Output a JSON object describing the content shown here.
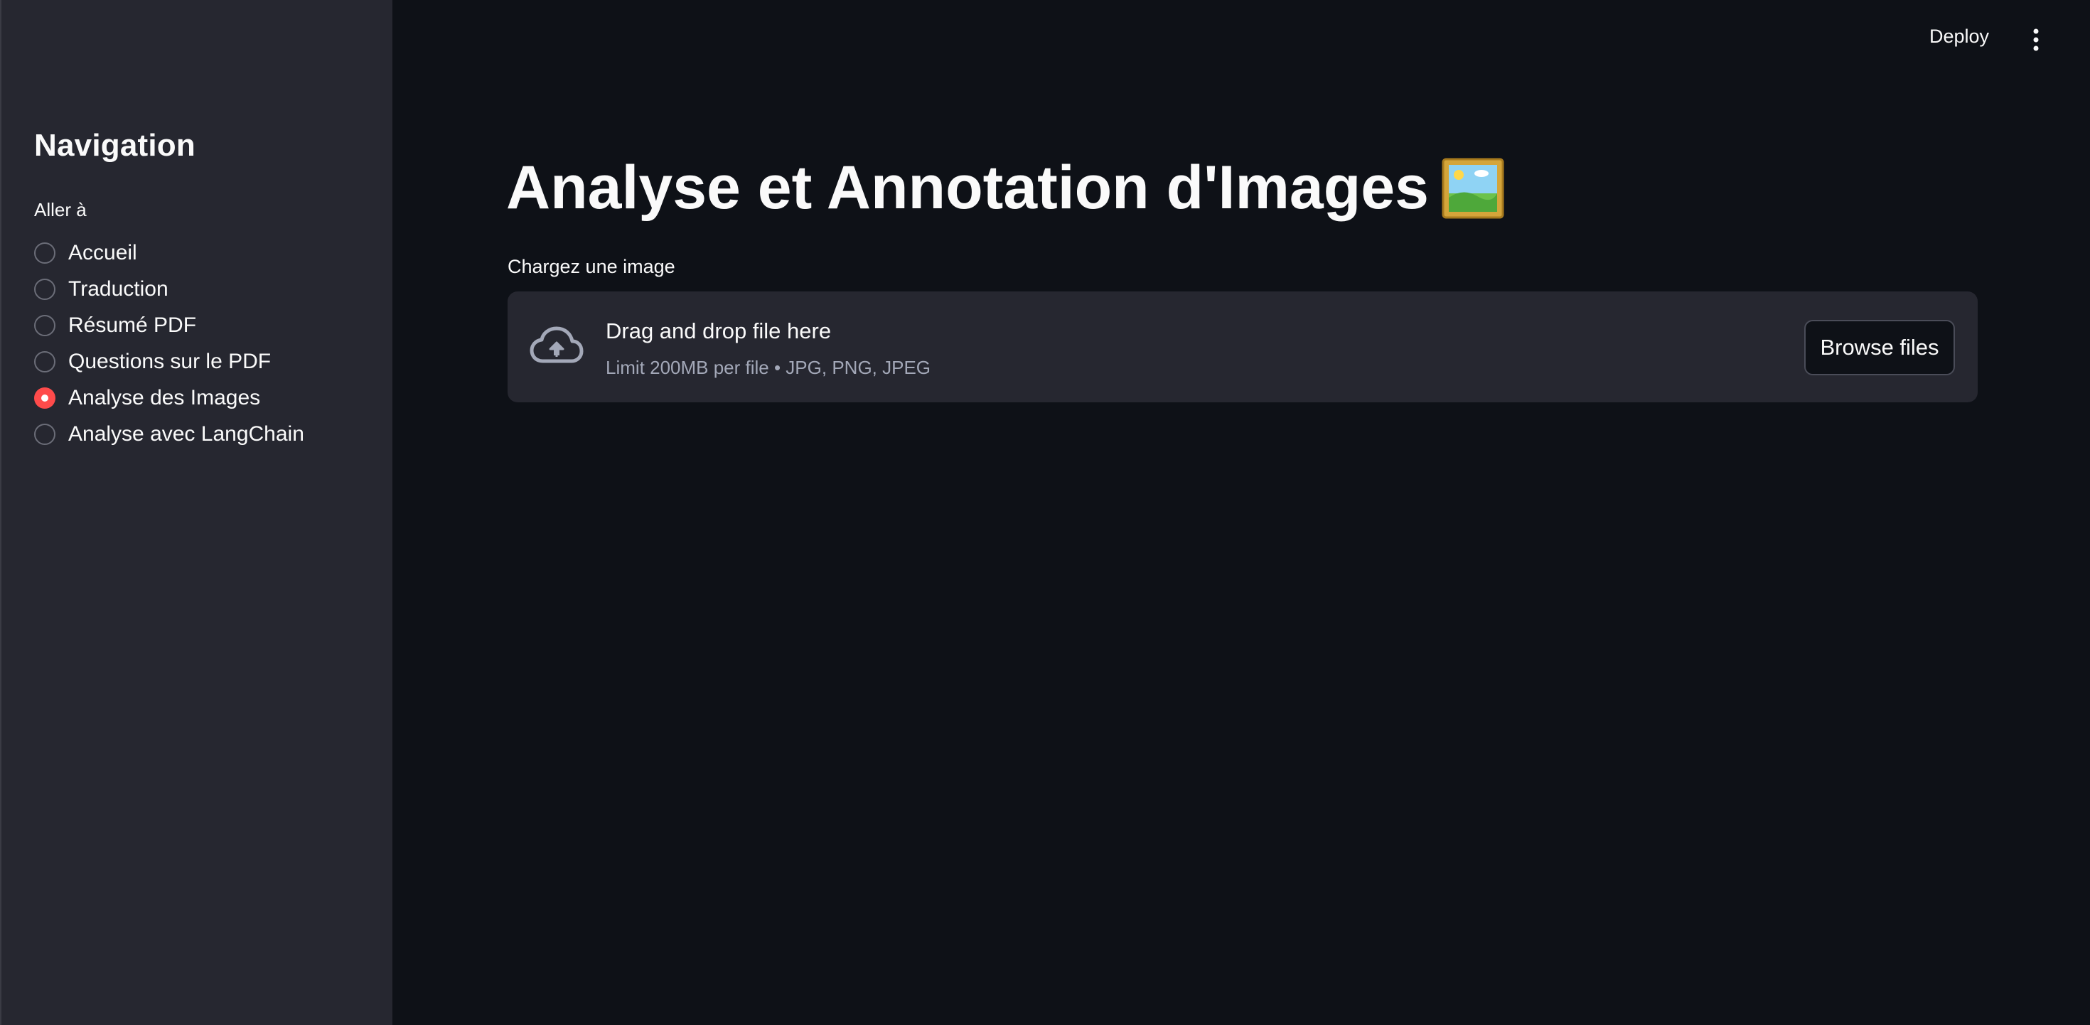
{
  "header": {
    "deploy_label": "Deploy",
    "menu_icon": "kebab-menu-icon"
  },
  "sidebar": {
    "title": "Navigation",
    "radio_label": "Aller à",
    "items": [
      {
        "label": "Accueil",
        "selected": false
      },
      {
        "label": "Traduction",
        "selected": false
      },
      {
        "label": "Résumé PDF",
        "selected": false
      },
      {
        "label": "Questions sur le PDF",
        "selected": false
      },
      {
        "label": "Analyse des Images",
        "selected": true
      },
      {
        "label": "Analyse avec LangChain",
        "selected": false
      }
    ]
  },
  "main": {
    "title": "Analyse et Annotation d'Images",
    "title_icon": "framed-picture-icon",
    "uploader": {
      "label": "Chargez une image",
      "drop_text": "Drag and drop file here",
      "limit_text": "Limit 200MB per file • JPG, PNG, JPEG",
      "browse_label": "Browse files",
      "icon": "cloud-upload-icon"
    }
  },
  "colors": {
    "background": "#0e1117",
    "sidebar": "#262730",
    "accent": "#ff4b4b",
    "text": "#fafafa",
    "muted_text": "#a3a8b8"
  }
}
